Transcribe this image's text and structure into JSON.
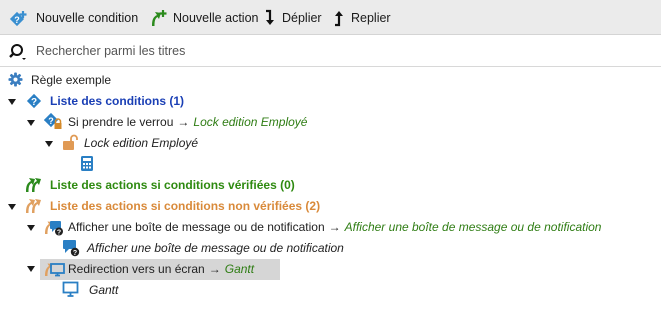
{
  "toolbar": {
    "new_condition": "Nouvelle condition",
    "new_action": "Nouvelle action",
    "expand": "Déplier",
    "collapse": "Replier"
  },
  "search": {
    "placeholder": "Rechercher parmi les titres",
    "value": ""
  },
  "tree": {
    "root": "Règle exemple",
    "conditions": {
      "label": "Liste des conditions (1)",
      "item": {
        "label": "Si prendre le verrou",
        "arrow": "→",
        "target": "Lock edition Employé",
        "child": "Lock edition Employé"
      }
    },
    "actions_true": {
      "label": "Liste des actions si conditions vérifiées (0)"
    },
    "actions_false": {
      "label": "Liste des actions si conditions non vérifiées (2)",
      "item1": {
        "label": "Afficher une boîte de message ou de notification",
        "arrow": "→",
        "target": "Afficher une boîte de message ou de notification",
        "child": "Afficher une boîte de message ou de notification"
      },
      "item2": {
        "label": "Redirection vers un écran",
        "arrow": "→",
        "target": "Gantt",
        "child": "Gantt"
      }
    }
  },
  "colors": {
    "conditions_header": "#1a3fb5",
    "actions_true_header": "#2e8a10",
    "actions_false_header": "#d98a3a",
    "target_text": "#2f7d14",
    "icon_blue": "#2a7fc4",
    "icon_green": "#2b8a1c",
    "icon_orange": "#e0a060"
  }
}
